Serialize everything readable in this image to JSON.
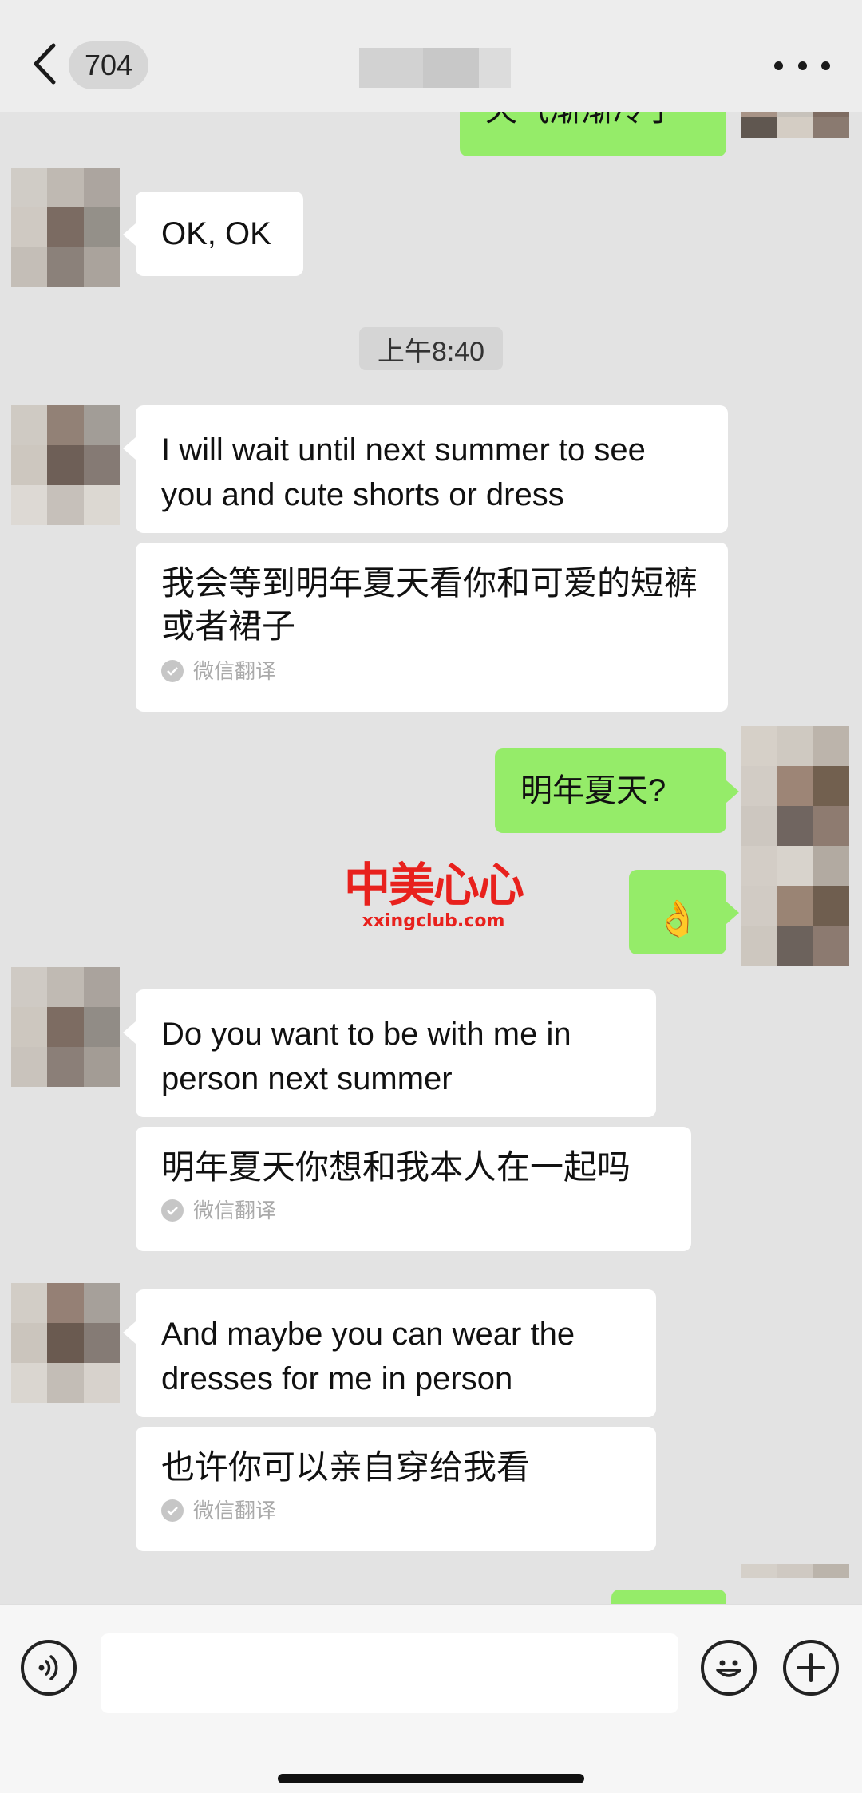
{
  "header": {
    "back_icon": "chevron-left-icon",
    "unread_count": "704",
    "more_icon": "more-dots-icon",
    "colors": {
      "background": "#ededed",
      "title_blur": [
        "#d2d2d2",
        "#c8c8c8",
        "#dcdcdc"
      ]
    }
  },
  "chat": {
    "messages": [
      {
        "side": "out",
        "text": "天气渐渐冷了"
      },
      {
        "side": "in",
        "text": "OK, OK"
      },
      {
        "type": "timestamp",
        "text": "上午8:40"
      },
      {
        "side": "in",
        "text": "I will wait until next summer to see you and cute shorts or dress",
        "translation": "我会等到明年夏天看你和可爱的短裤或者裙子",
        "translation_tag": "微信翻译"
      },
      {
        "side": "out",
        "text": "明年夏天?"
      },
      {
        "side": "out",
        "text": "👌"
      },
      {
        "side": "in",
        "text": "Do you want to be with me in person next summer",
        "translation": "明年夏天你想和我本人在一起吗",
        "translation_tag": "微信翻译"
      },
      {
        "side": "in",
        "text": "And maybe you can wear the dresses for me in person",
        "translation": "也许你可以亲自穿给我看",
        "translation_tag": "微信翻译"
      },
      {
        "side": "out",
        "text": ""
      }
    ],
    "colors": {
      "incoming_bubble": "#ffffff",
      "outgoing_bubble": "#95ec69",
      "chat_bg": "#e3e3e3"
    }
  },
  "watermark": {
    "title": "中美心心",
    "subtitle": "xxingclub.com",
    "color": "#e8211d"
  },
  "input_bar": {
    "voice_icon": "voice-icon",
    "emoji_icon": "smiley-icon",
    "plus_icon": "plus-icon",
    "input_value": ""
  }
}
